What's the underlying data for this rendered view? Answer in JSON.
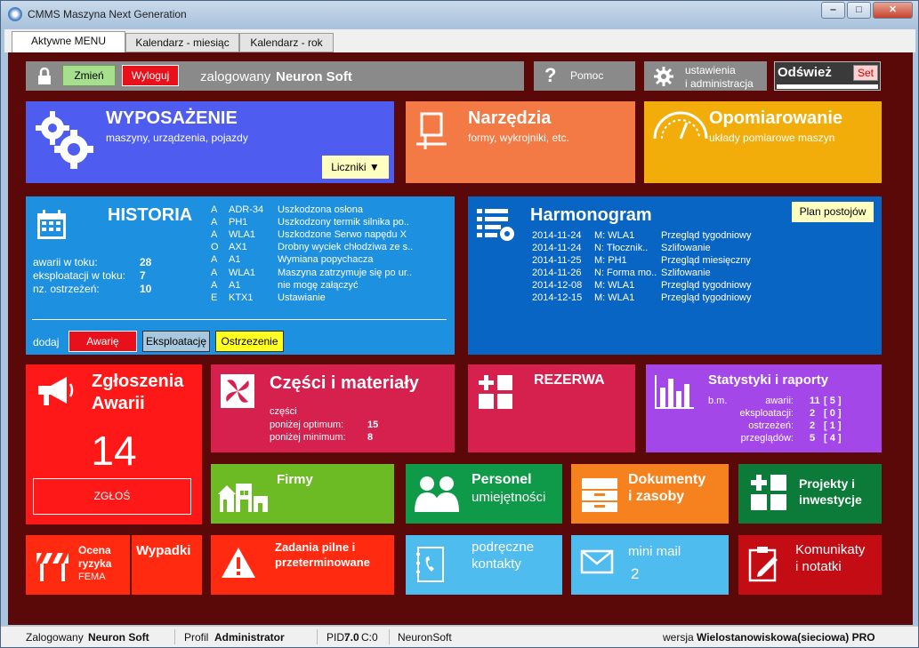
{
  "window": {
    "title": "CMMS Maszyna Next Generation",
    "minimize": "‒",
    "maximize": "□",
    "close": "✕"
  },
  "tabs": [
    "Aktywne MENU",
    "Kalendarz - miesiąc",
    "Kalendarz - rok"
  ],
  "topbar": {
    "change_label": "Zmień",
    "logout_label": "Wyloguj",
    "logged_prefix": "zalogowany",
    "logged_user": "Neuron Soft",
    "help_label": "Pomoc",
    "settings_line1": "ustawienia",
    "settings_line2": "i administracja",
    "refresh_label": "Odśwież",
    "set_label": "Set"
  },
  "wyposazenie": {
    "title": "WYPOSAŻENIE",
    "subtitle": "maszyny, urządzenia, pojazdy",
    "counters_label": "Liczniki"
  },
  "narzedzia": {
    "title": "Narzędzia",
    "subtitle": "formy, wykrojniki, etc."
  },
  "opomiarowanie": {
    "title": "Opomiarowanie",
    "subtitle": "układy pomiarowe maszyn"
  },
  "historia": {
    "title": "HISTORIA",
    "stats": [
      {
        "label": "awarii w toku:",
        "value": "28"
      },
      {
        "label": "eksploatacji w toku:",
        "value": "7"
      },
      {
        "label": "nz. ostrzeżeń:",
        "value": "10"
      }
    ],
    "rows": [
      {
        "type": "A",
        "code": "ADR-34",
        "desc": "Uszkodzona osłona"
      },
      {
        "type": "A",
        "code": "PH1",
        "desc": "Uszkodzony termik silnika po.."
      },
      {
        "type": "A",
        "code": "WLA1",
        "desc": "Uszkodzone Serwo napędu X"
      },
      {
        "type": "O",
        "code": "AX1",
        "desc": "Drobny wyciek chłodziwa ze s.."
      },
      {
        "type": "A",
        "code": "A1",
        "desc": "Wymiana popychacza"
      },
      {
        "type": "A",
        "code": "WLA1",
        "desc": "Maszyna zatrzymuje się po ur.."
      },
      {
        "type": "A",
        "code": "A1",
        "desc": "nie mogę załączyć"
      },
      {
        "type": "E",
        "code": "KTX1",
        "desc": "Ustawianie"
      }
    ],
    "add_label": "dodaj",
    "btn_failure": "Awarię",
    "btn_operation": "Eksploatację",
    "btn_warning": "Ostrzezenie"
  },
  "harmonogram": {
    "title": "Harmonogram",
    "plan_label": "Plan postojów",
    "rows": [
      {
        "date": "2014-11-24",
        "machine": "M: WLA1",
        "task": "Przegląd tygodniowy"
      },
      {
        "date": "2014-11-24",
        "machine": "N: Tłocznik..",
        "task": "Szlifowanie"
      },
      {
        "date": "2014-11-25",
        "machine": "M: PH1",
        "task": "Przegląd miesięczny"
      },
      {
        "date": "2014-11-26",
        "machine": "N: Forma mo..",
        "task": "Szlifowanie"
      },
      {
        "date": "2014-12-08",
        "machine": "M: WLA1",
        "task": "Przegląd tygodniowy"
      },
      {
        "date": "2014-12-15",
        "machine": "M: WLA1",
        "task": "Przegląd tygodniowy"
      }
    ]
  },
  "zgloszenia": {
    "title1": "Zgłoszenia",
    "title2": "Awarii",
    "count": "14",
    "report_label": "ZGŁOŚ"
  },
  "czesci": {
    "title": "Części i materiały",
    "sub": "części",
    "rows": [
      {
        "label": "poniżej optimum:",
        "value": "15"
      },
      {
        "label": "poniżej minimum:",
        "value": "8"
      }
    ]
  },
  "rezerwa": {
    "title": "REZERWA"
  },
  "statystyki": {
    "title": "Statystyki i raporty",
    "period": "b.m.",
    "rows": [
      {
        "label": "awarii:",
        "value": "11",
        "extra": "[ 5 ]"
      },
      {
        "label": "eksploatacji:",
        "value": "2",
        "extra": "[ 0 ]"
      },
      {
        "label": "ostrzeżeń:",
        "value": "2",
        "extra": "[ 1 ]"
      },
      {
        "label": "przeglądów:",
        "value": "5",
        "extra": "[ 4 ]"
      }
    ]
  },
  "firmy": {
    "title": "Firmy"
  },
  "personel": {
    "title": "Personel",
    "subtitle": "umiejętności"
  },
  "dokumenty": {
    "title1": "Dokumenty",
    "title2": "i zasoby"
  },
  "projekty": {
    "title1": "Projekty i",
    "title2": "inwestycje"
  },
  "ocena": {
    "title1": "Ocena",
    "title2": "ryzyka",
    "sub": "FEMA"
  },
  "wypadki": {
    "title": "Wypadki"
  },
  "zadania": {
    "title1": "Zadania pilne i",
    "title2": "przeterminowane"
  },
  "kontakty": {
    "title1": "podręczne",
    "title2": "kontakty"
  },
  "minimail": {
    "title": "mini mail",
    "count": "2"
  },
  "komunikaty": {
    "title1": "Komunikaty",
    "title2": "i notatki"
  },
  "statusbar": {
    "logged_label": "Zalogowany",
    "logged_user": "Neuron Soft",
    "profile_label": "Profil",
    "profile_value": "Administrator",
    "pid_label": "PID:",
    "pid_value": "7.0",
    "c_value": "C:0",
    "company": "NeuronSoft",
    "version_label": "wersja",
    "version_value": "Wielostanowiskowa(sieciowa) PRO"
  },
  "colors": {
    "background": "#5a0808",
    "wyposazenie": "#4f5cf0",
    "narzedzia": "#f37a45",
    "opomiarowanie": "#f2ad0b",
    "historia": "#1e90e0",
    "harmonogram": "#0865c4",
    "zgloszenia": "#ff1818",
    "czesci": "#d6204e",
    "statystyki": "#a347e8",
    "firmy": "#6cba24",
    "personel": "#0e9a48",
    "dokumenty": "#f5821f",
    "projekty": "#0c7a38",
    "kontakty": "#4fbcf0",
    "komunikaty": "#c40c14"
  }
}
